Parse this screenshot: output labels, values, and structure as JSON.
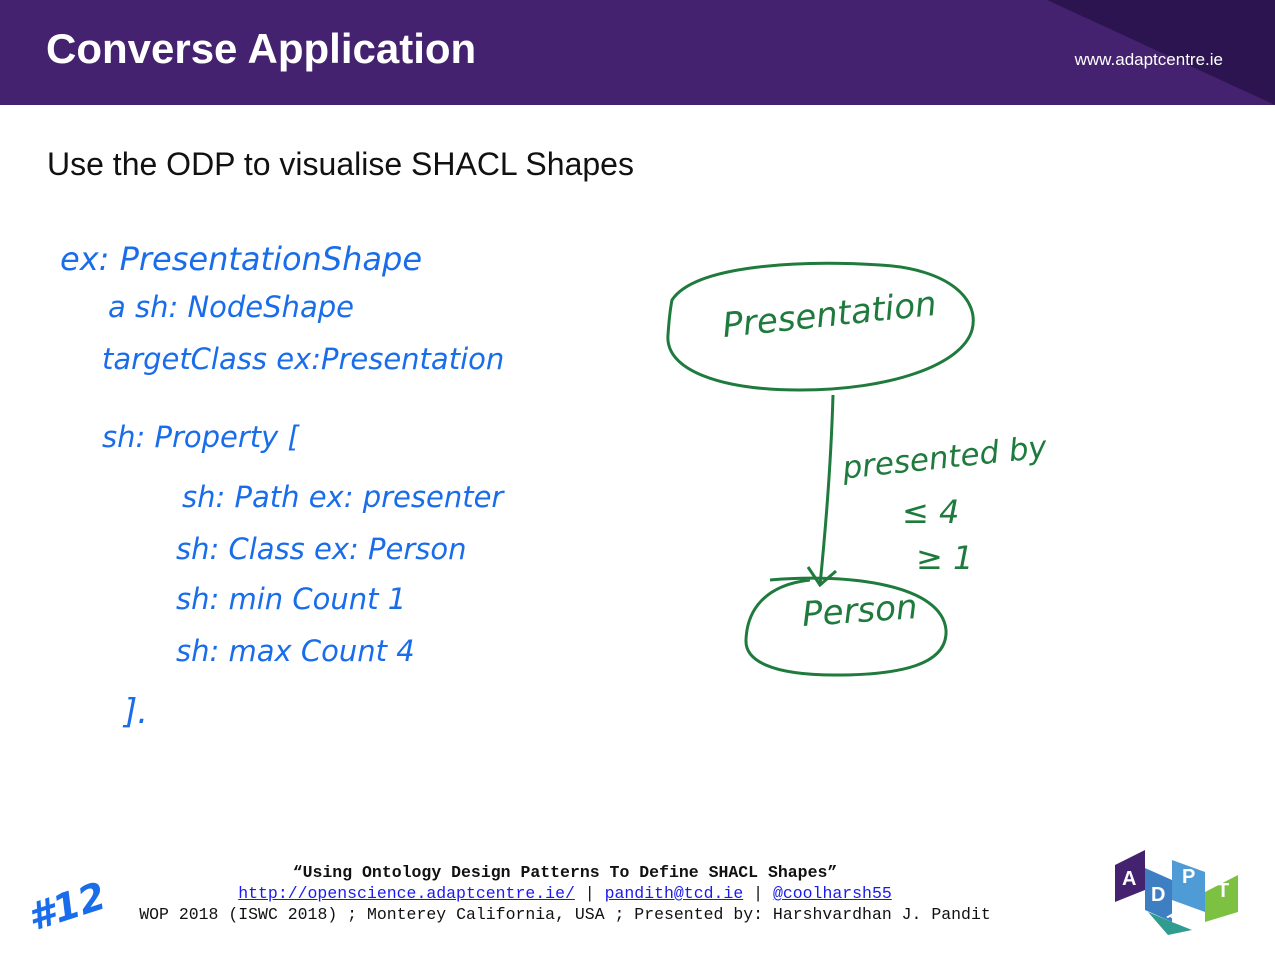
{
  "header": {
    "title": "Converse Application",
    "website": "www.adaptcentre.ie"
  },
  "subtitle": "Use the ODP to visualise SHACL Shapes",
  "shacl": {
    "lines": [
      "ex: PresentationShape",
      "a sh: NodeShape",
      "targetClass ex:Presentation",
      "sh: Property [",
      "sh: Path ex: presenter",
      "sh: Class ex: Person",
      "sh: min Count 1",
      "sh: max Count 4",
      "]."
    ]
  },
  "diagram": {
    "top_node": "Presentation",
    "bottom_node": "Person",
    "edge_label": "presented by",
    "constraint_max": "≤ 4",
    "constraint_min": "≥ 1"
  },
  "footer": {
    "citation": "“Using Ontology Design Patterns To Define SHACL Shapes”",
    "link_url": "http://openscience.adaptcentre.ie/",
    "separator": "|",
    "email": "pandith@tcd.ie",
    "twitter": "@coolharsh55",
    "venue": "WOP 2018 (ISWC 2018) ; Monterey California, USA ; Presented by: Harshvardhan J. Pandit"
  },
  "slide_number": "#12",
  "logo": {
    "letters": [
      "A",
      "D",
      "A",
      "P",
      "T"
    ],
    "colors": [
      "#45226f",
      "#3e7fc4",
      "#2f9c8f",
      "#4f9bd6",
      "#7dc142"
    ]
  }
}
